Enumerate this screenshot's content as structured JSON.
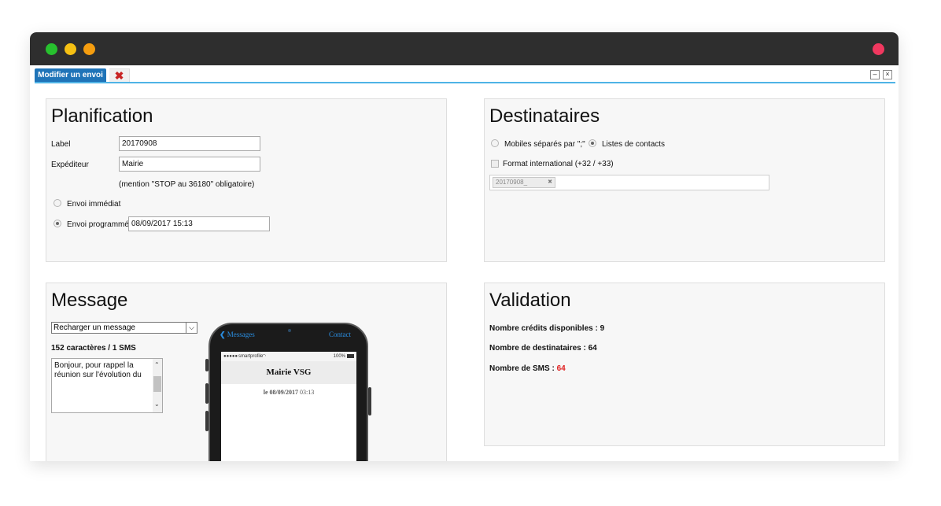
{
  "window": {
    "tab_label": "Modifier un envoi",
    "tab_close_glyph": "✖",
    "minimize_glyph": "–",
    "close_glyph": "×"
  },
  "planification": {
    "title": "Planification",
    "label_caption": "Label",
    "label_value": "20170908",
    "expediteur_caption": "Expéditeur",
    "expediteur_value": "Mairie",
    "mention": "(mention \"STOP au 36180\" obligatoire)",
    "envoi_immediat": "Envoi immédiat",
    "envoi_programme": "Envoi programmé",
    "envoi_programme_value": "08/09/2017 15:13",
    "selected_mode": "programme"
  },
  "destinataires": {
    "title": "Destinataires",
    "option_mobiles": "Mobiles séparés par \";\"",
    "option_listes": "Listes de contacts",
    "selected": "listes",
    "format_international": "Format international (+32 / +33)",
    "tag": "20170908_",
    "tag_remove_glyph": "✖"
  },
  "message": {
    "title": "Message",
    "reload_select": "Recharger un message",
    "char_count": "152 caractères / 1 SMS",
    "textarea_text": "Bonjour, pour rappel la réunion sur l'évolution du"
  },
  "phone": {
    "back_label": "Messages",
    "contact_label": "Contact",
    "carrier": "smartprofile",
    "battery": "100%",
    "sender": "Mairie VSG",
    "date_prefix": "le",
    "date": "08/09/2017",
    "time": "03:13"
  },
  "validation": {
    "title": "Validation",
    "credits_label": "Nombre crédits disponibles :",
    "credits_value": "9",
    "dest_label": "Nombre de destinataires :",
    "dest_value": "64",
    "sms_label": "Nombre de SMS :",
    "sms_value": "64"
  },
  "colors": {
    "tab_active": "#1f74b8",
    "tab_underline": "#4fb3e6",
    "sms_count_highlight": "#e02020",
    "titlebar": "#2e2e2e"
  }
}
